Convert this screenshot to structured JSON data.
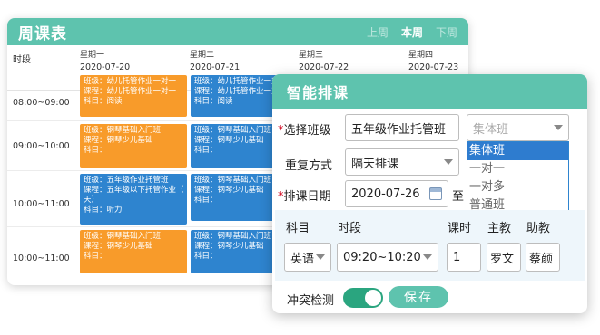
{
  "timetable": {
    "title": "周课表",
    "nav": {
      "prev": "上周",
      "current": "本周",
      "next": "下周"
    },
    "time_header": "时段",
    "days": [
      {
        "label": "星期一",
        "date": "2020-07-20"
      },
      {
        "label": "星期二",
        "date": "2020-07-21"
      },
      {
        "label": "星期三",
        "date": "2020-07-22"
      },
      {
        "label": "星期四",
        "date": "2020-07-23"
      }
    ],
    "slots": [
      "08:00~09:00",
      "09:00~10:00",
      "10:00~11:00",
      "10:00~11:00"
    ],
    "lessons": [
      {
        "line1": "班级：幼儿托管作业一对一",
        "line2": "课程：幼儿托管作业一对一",
        "line3": "科目：阅读"
      },
      {
        "line1": "班级：幼儿托管作业一对一",
        "line2": "课程：幼儿托管作业一对一",
        "line3": "科目：阅读"
      },
      {
        "line1": "班级：钢琴基础入门班",
        "line2": "课程：钢琴少儿基础",
        "line3": "科目："
      },
      {
        "line1": "班级：钢琴基础入门班",
        "line2": "课程：钢琴少儿基础",
        "line3": "科目："
      },
      {
        "line1": "班级：五年级作业托管班",
        "line2": "课程：五年级以下托管作业（",
        "line3": "天）",
        "line4": "科目：听力"
      },
      {
        "line1": "班级：钢琴基础入门班",
        "line2": "课程：钢琴少儿基础",
        "line3": "科目："
      },
      {
        "line1": "班级：钢琴基础入门班",
        "line2": "课程：钢琴少儿基础",
        "line3": "科目："
      },
      {
        "line1": "班级：钢琴基础入门班",
        "line2": "课程：钢琴少儿基础",
        "line3": "科目："
      }
    ]
  },
  "dialog": {
    "title": "智能排课",
    "class_label": "选择班级",
    "class_value": "五年级作业托管班",
    "class_type_placeholder": "集体班",
    "class_type_options": [
      "集体班",
      "一对一",
      "一对多",
      "普通班"
    ],
    "repeat_label": "重复方式",
    "repeat_value": "隔天排课",
    "date_label": "排课日期",
    "date_value": "2020-07-26",
    "date_to": "至",
    "table": {
      "headers": {
        "subject": "科目",
        "period": "时段",
        "hours": "课时",
        "teacher": "主教",
        "assistant": "助教"
      },
      "row": {
        "subject": "英语",
        "period": "09:20~10:20",
        "hours": "1",
        "teacher": "罗文",
        "assistant": "蔡颜"
      }
    },
    "conflict_label": "冲突检测",
    "conflict_on": true,
    "save_label": "保存"
  },
  "colors": {
    "accent": "#5ec3ae",
    "orange": "#f89b2a",
    "blue": "#2e84cf",
    "toggle": "#2aa57f"
  }
}
